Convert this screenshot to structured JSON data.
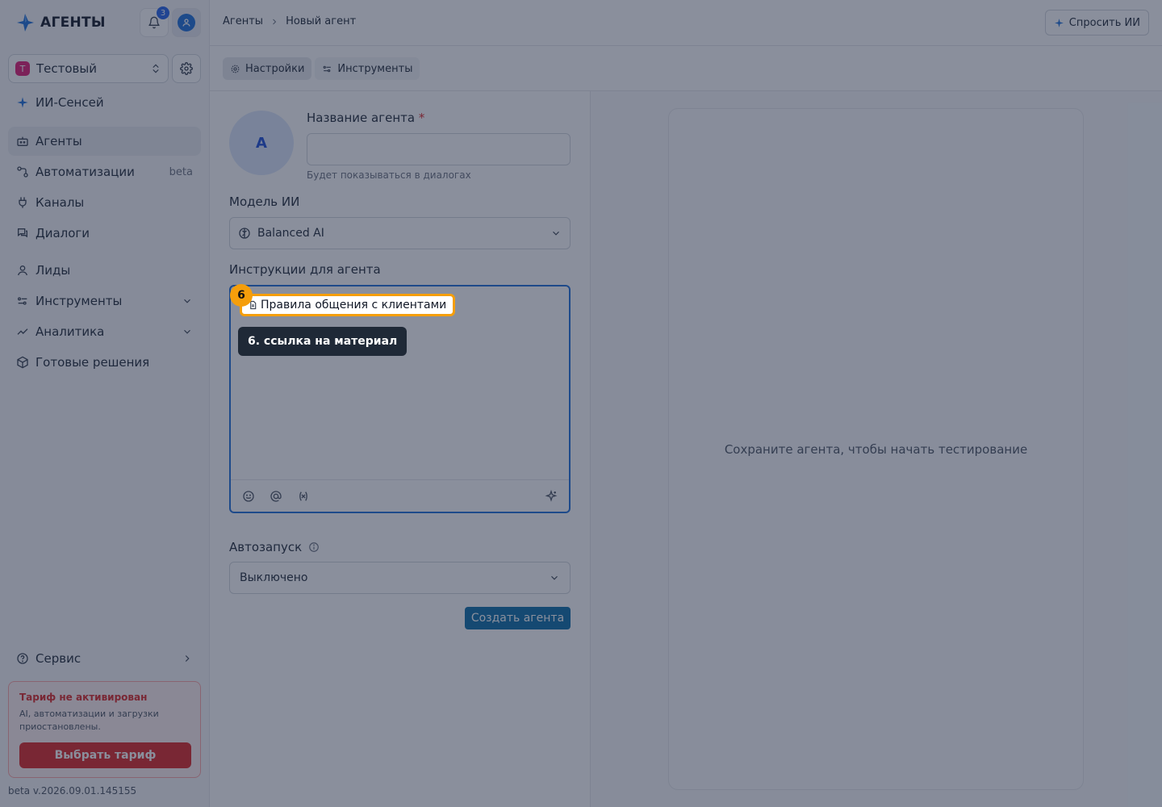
{
  "brand": {
    "name": "АГЕНТЫ"
  },
  "notifications": {
    "count": "3"
  },
  "workspace": {
    "initial": "Т",
    "name": "Тестовый"
  },
  "sidebar": {
    "items": [
      {
        "label": "ИИ-Сенсей",
        "icon": "sparkle-icon"
      },
      {
        "label": "Агенты",
        "icon": "bot-icon"
      },
      {
        "label": "Автоматизации",
        "icon": "workflow-icon",
        "badge": "beta"
      },
      {
        "label": "Каналы",
        "icon": "plug-icon"
      },
      {
        "label": "Диалоги",
        "icon": "chat-icon"
      },
      {
        "label": "Лиды",
        "icon": "user-icon"
      },
      {
        "label": "Инструменты",
        "icon": "tools-icon"
      },
      {
        "label": "Аналитика",
        "icon": "chart-icon"
      },
      {
        "label": "Готовые решения",
        "icon": "package-icon"
      }
    ],
    "service": "Сервис"
  },
  "plan": {
    "title": "Тариф не активирован",
    "text": "AI, автоматизации и загрузки приостановлены.",
    "button": "Выбрать тариф"
  },
  "version": "beta v.2026.09.01.145155",
  "header": {
    "breadcrumb": [
      "Агенты",
      "Новый агент"
    ],
    "ask_ai": "Спросить ИИ"
  },
  "tabs": [
    {
      "label": "Настройки",
      "icon": "gear-icon"
    },
    {
      "label": "Инструменты",
      "icon": "tools-icon"
    }
  ],
  "form": {
    "avatar_initial": "A",
    "name_label": "Название агента",
    "required_mark": "*",
    "name_value": "",
    "name_hint": "Будет показываться в диалогах",
    "model_label": "Модель ИИ",
    "model_value": "Balanced AI",
    "instructions_label": "Инструкции для агента",
    "mention_chip": "Правила общения с клиентами",
    "marker": "6",
    "tooltip": "6. ссылка на материал",
    "autostart_label": "Автозапуск",
    "autostart_value": "Выключено",
    "create_button": "Создать агента"
  },
  "preview": {
    "text": "Сохраните агента, чтобы начать тестирование"
  },
  "colors": {
    "accent": "#1e6fd9",
    "primary_button": "#0b6ea8",
    "highlight": "#f59e0b",
    "danger": "#dc2626"
  }
}
